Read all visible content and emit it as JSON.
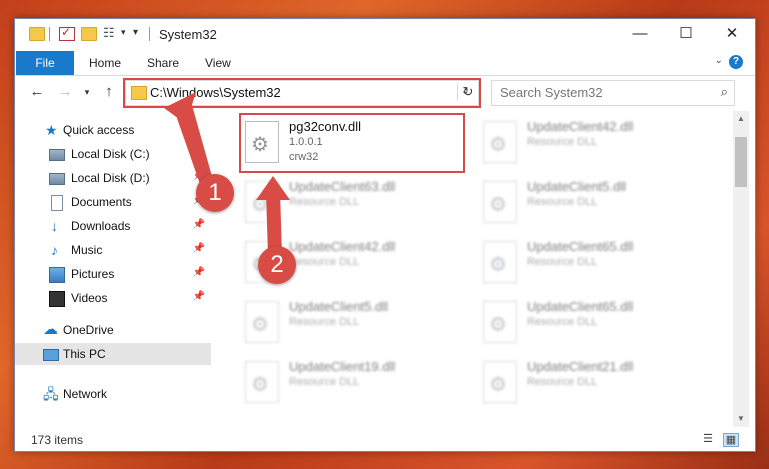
{
  "window": {
    "title": "System32",
    "controls": {
      "minimize": "—",
      "maximize": "☐",
      "close": "✕"
    }
  },
  "ribbon": {
    "tabs": [
      "File",
      "Home",
      "Share",
      "View"
    ],
    "help": "?"
  },
  "address": {
    "path": "C:\\Windows\\System32",
    "search_placeholder": "Search System32"
  },
  "nav_pane": {
    "items": [
      {
        "label": "Quick access",
        "icon": "star-icon",
        "pinned": false
      },
      {
        "label": "Local Disk (C:)",
        "icon": "drive-icon",
        "pinned": true
      },
      {
        "label": "Local Disk (D:)",
        "icon": "drive-icon",
        "pinned": true
      },
      {
        "label": "Documents",
        "icon": "documents-icon",
        "pinned": true
      },
      {
        "label": "Downloads",
        "icon": "download-icon",
        "pinned": true
      },
      {
        "label": "Music",
        "icon": "music-icon",
        "pinned": true
      },
      {
        "label": "Pictures",
        "icon": "pictures-icon",
        "pinned": true
      },
      {
        "label": "Videos",
        "icon": "videos-icon",
        "pinned": true
      },
      {
        "label": "OneDrive",
        "icon": "onedrive-icon",
        "pinned": false
      },
      {
        "label": "This PC",
        "icon": "computer-icon",
        "pinned": false,
        "selected": true
      },
      {
        "label": "Network",
        "icon": "network-icon",
        "pinned": false
      }
    ]
  },
  "files": [
    {
      "name": "pg32conv.dll",
      "line2": "1.0.0.1",
      "line3": "crw32",
      "highlighted": true
    },
    {
      "name": "UpdateClient42.dll",
      "line2": "Resource DLL",
      "blurred": true
    },
    {
      "name": "UpdateClient63.dll",
      "line2": "Resource DLL",
      "blurred": true
    },
    {
      "name": "UpdateClient5.dll",
      "line2": "Resource DLL",
      "blurred": true
    },
    {
      "name": "UpdateClient42.dll",
      "line2": "Resource DLL",
      "blurred": true
    },
    {
      "name": "UpdateClient65.dll",
      "line2": "Resource DLL",
      "blurred": true
    },
    {
      "name": "UpdateClient5.dll",
      "line2": "Resource DLL",
      "blurred": true
    },
    {
      "name": "UpdateClient65.dll",
      "line2": "Resource DLL",
      "blurred": true
    },
    {
      "name": "UpdateClient19.dll",
      "line2": "Resource DLL",
      "blurred": true
    },
    {
      "name": "UpdateClient21.dll",
      "line2": "Resource DLL",
      "blurred": true
    }
  ],
  "status": {
    "item_count": "173 items"
  },
  "callouts": {
    "one": "1",
    "two": "2"
  },
  "colors": {
    "accent": "#1979ca",
    "callout": "#d94b45",
    "highlight": "#d84a4a"
  }
}
